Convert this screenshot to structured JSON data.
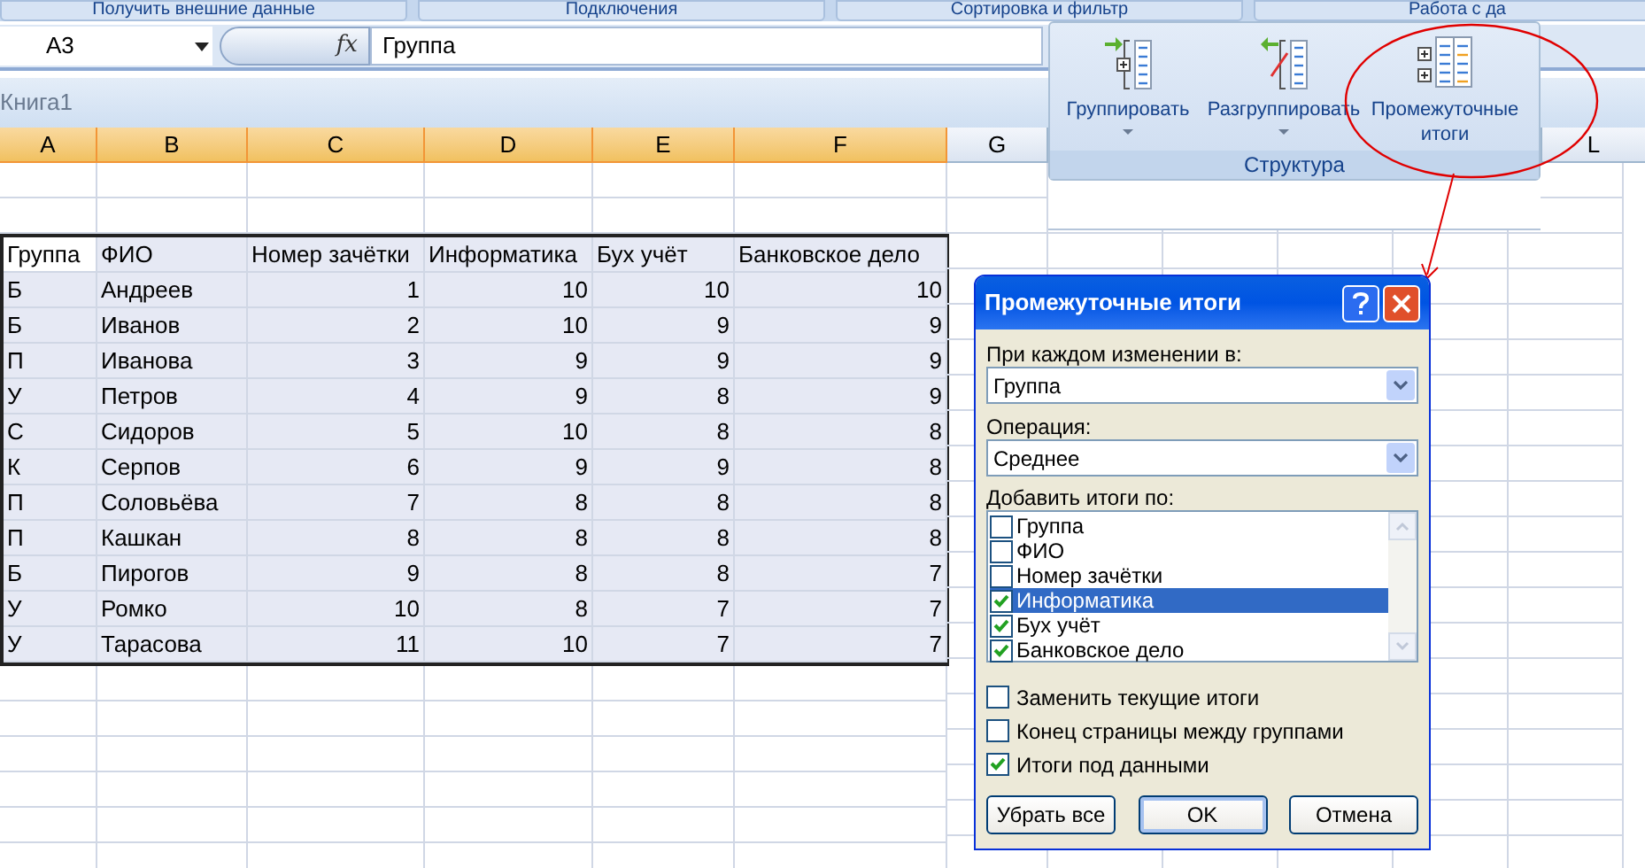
{
  "ribbon_tabs": [
    {
      "label": "Получить внешние данные"
    },
    {
      "label": "Подключения"
    },
    {
      "label": "Сортировка и фильтр"
    },
    {
      "label": "Работа с да"
    }
  ],
  "name_box": {
    "value": "A3"
  },
  "formula_bar": {
    "function_label": "fx",
    "value": "Группа"
  },
  "workbook": {
    "title": "Книга1"
  },
  "sheet_columns": [
    "A",
    "B",
    "C",
    "D",
    "E",
    "F",
    "G",
    "L"
  ],
  "table": {
    "columns": [
      {
        "label": "Группа",
        "active": true
      },
      {
        "label": "ФИО",
        "active": false
      },
      {
        "label": "Номер зачётки",
        "active": false
      },
      {
        "label": "Информатика",
        "active": false
      },
      {
        "label": "Бух учёт",
        "active": false
      },
      {
        "label": "Банковское дело",
        "active": false
      }
    ],
    "rows": [
      [
        "Б",
        "Андреев",
        "1",
        "10",
        "10",
        "10"
      ],
      [
        "Б",
        "Иванов",
        "2",
        "10",
        "9",
        "9"
      ],
      [
        "П",
        "Иванова",
        "3",
        "9",
        "9",
        "9"
      ],
      [
        "У",
        "Петров",
        "4",
        "9",
        "8",
        "9"
      ],
      [
        "С",
        "Сидоров",
        "5",
        "10",
        "8",
        "8"
      ],
      [
        "К",
        "Серпов",
        "6",
        "9",
        "9",
        "8"
      ],
      [
        "П",
        "Соловьёва",
        "7",
        "8",
        "8",
        "8"
      ],
      [
        "П",
        "Кашкан",
        "8",
        "8",
        "8",
        "8"
      ],
      [
        "Б",
        "Пирогов",
        "9",
        "8",
        "8",
        "7"
      ],
      [
        "У",
        "Ромко",
        "10",
        "8",
        "7",
        "7"
      ],
      [
        "У",
        "Тарасова",
        "11",
        "10",
        "7",
        "7"
      ]
    ]
  },
  "ribbon_group": {
    "title": "Структура",
    "buttons": [
      {
        "kind": "group",
        "label": "Группировать",
        "dropdown": true
      },
      {
        "kind": "ungroup",
        "label": "Разгруппировать",
        "dropdown": true
      },
      {
        "kind": "subtotal",
        "label": "Промежуточные итоги",
        "dropdown": false
      }
    ]
  },
  "dialog": {
    "title": "Промежуточные итоги",
    "change_field": {
      "label": "При каждом изменении в:",
      "value": "Группа"
    },
    "operation": {
      "label": "Операция:",
      "value": "Среднее"
    },
    "add_totals": {
      "label": "Добавить итоги по:",
      "items": [
        {
          "label": "Группа",
          "checked": false,
          "selected": false
        },
        {
          "label": "ФИО",
          "checked": false,
          "selected": false
        },
        {
          "label": "Номер зачётки",
          "checked": false,
          "selected": false
        },
        {
          "label": "Информатика",
          "checked": true,
          "selected": true
        },
        {
          "label": "Бух учёт",
          "checked": true,
          "selected": false
        },
        {
          "label": "Банковское дело",
          "checked": true,
          "selected": false
        }
      ]
    },
    "options": [
      {
        "label": "Заменить текущие итоги",
        "checked": false
      },
      {
        "label": "Конец страницы между группами",
        "checked": false
      },
      {
        "label": "Итоги под данными",
        "checked": true
      }
    ],
    "buttons": [
      {
        "label": "Убрать все",
        "default": false
      },
      {
        "label": "OK",
        "default": true
      },
      {
        "label": "Отмена",
        "default": false
      }
    ]
  }
}
